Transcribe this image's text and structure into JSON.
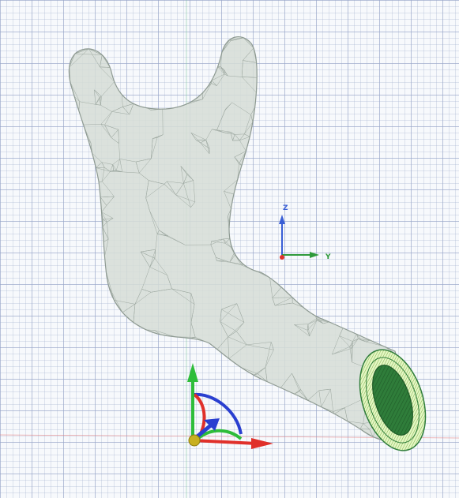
{
  "viewport": {
    "background": "#f7f9fc",
    "grid_color": "#96a5c8"
  },
  "model": {
    "fill": "#d6ddd6",
    "wire": "#8e9a92",
    "section_fill": "#2f7d3a",
    "section_ring": "#dff5b8"
  },
  "view_triad": {
    "z_label": "Z",
    "y_label": "Y",
    "z_color": "#3a5fd6",
    "y_color": "#2f9a3a",
    "x_color": "#e0302a"
  },
  "manipulator": {
    "x_color": "#e0302a",
    "y_color": "#2ebd3a",
    "z_color": "#2a3fd0",
    "center_color": "#c8b020",
    "icon": "move-rotate-gizmo-icon"
  }
}
